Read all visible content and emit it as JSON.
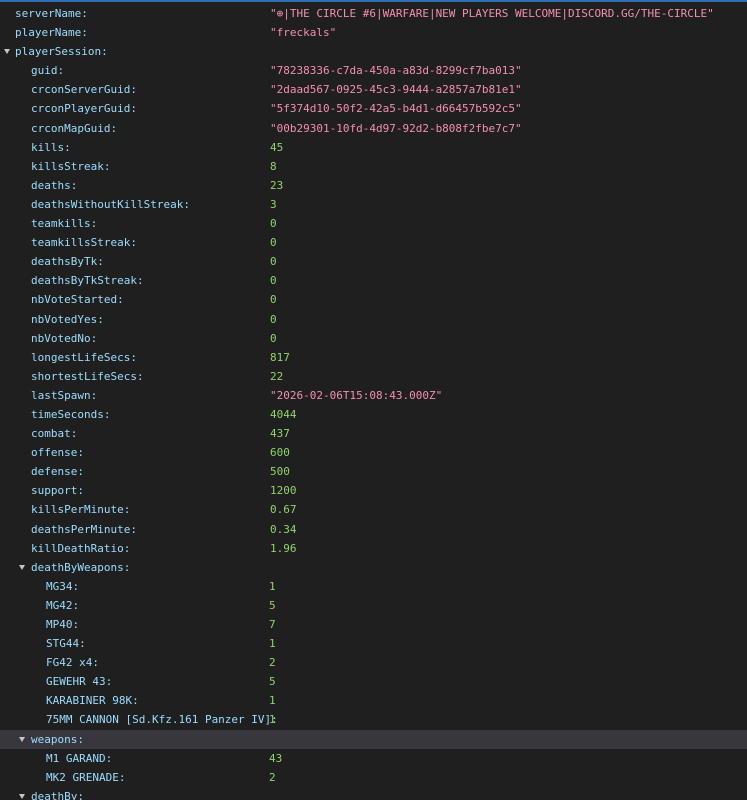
{
  "colors": {
    "background": "#1f1f1f",
    "key": "#9cdcfe",
    "string": "#f48fb1",
    "number": "#8fd46e",
    "selected_row": "#37373d",
    "accent": "#2f6fb8"
  },
  "rows": [
    {
      "depth": 0,
      "key": "serverName:",
      "value": "\"⊕|THE CIRCLE #6|WARFARE|NEW PLAYERS WELCOME|DISCORD.GG/THE-CIRCLE\"",
      "type": "str"
    },
    {
      "depth": 0,
      "key": "playerName:",
      "value": "\"freckals\"",
      "type": "str"
    },
    {
      "depth": 0,
      "key": "playerSession:",
      "expand": true
    },
    {
      "depth": 1,
      "key": "guid:",
      "value": "\"78238336-c7da-450a-a83d-8299cf7ba013\"",
      "type": "str"
    },
    {
      "depth": 1,
      "key": "crconServerGuid:",
      "value": "\"2daad567-0925-45c3-9444-a2857a7b81e1\"",
      "type": "str"
    },
    {
      "depth": 1,
      "key": "crconPlayerGuid:",
      "value": "\"5f374d10-50f2-42a5-b4d1-d66457b592c5\"",
      "type": "str"
    },
    {
      "depth": 1,
      "key": "crconMapGuid:",
      "value": "\"00b29301-10fd-4d97-92d2-b808f2fbe7c7\"",
      "type": "str"
    },
    {
      "depth": 1,
      "key": "kills:",
      "value": "45",
      "type": "num"
    },
    {
      "depth": 1,
      "key": "killsStreak:",
      "value": "8",
      "type": "num"
    },
    {
      "depth": 1,
      "key": "deaths:",
      "value": "23",
      "type": "num"
    },
    {
      "depth": 1,
      "key": "deathsWithoutKillStreak:",
      "value": "3",
      "type": "num"
    },
    {
      "depth": 1,
      "key": "teamkills:",
      "value": "0",
      "type": "num"
    },
    {
      "depth": 1,
      "key": "teamkillsStreak:",
      "value": "0",
      "type": "num"
    },
    {
      "depth": 1,
      "key": "deathsByTk:",
      "value": "0",
      "type": "num"
    },
    {
      "depth": 1,
      "key": "deathsByTkStreak:",
      "value": "0",
      "type": "num"
    },
    {
      "depth": 1,
      "key": "nbVoteStarted:",
      "value": "0",
      "type": "num"
    },
    {
      "depth": 1,
      "key": "nbVotedYes:",
      "value": "0",
      "type": "num"
    },
    {
      "depth": 1,
      "key": "nbVotedNo:",
      "value": "0",
      "type": "num"
    },
    {
      "depth": 1,
      "key": "longestLifeSecs:",
      "value": "817",
      "type": "num"
    },
    {
      "depth": 1,
      "key": "shortestLifeSecs:",
      "value": "22",
      "type": "num"
    },
    {
      "depth": 1,
      "key": "lastSpawn:",
      "value": "\"2026-02-06T15:08:43.000Z\"",
      "type": "str"
    },
    {
      "depth": 1,
      "key": "timeSeconds:",
      "value": "4044",
      "type": "num"
    },
    {
      "depth": 1,
      "key": "combat:",
      "value": "437",
      "type": "num"
    },
    {
      "depth": 1,
      "key": "offense:",
      "value": "600",
      "type": "num"
    },
    {
      "depth": 1,
      "key": "defense:",
      "value": "500",
      "type": "num"
    },
    {
      "depth": 1,
      "key": "support:",
      "value": "1200",
      "type": "num"
    },
    {
      "depth": 1,
      "key": "killsPerMinute:",
      "value": "0.67",
      "type": "num"
    },
    {
      "depth": 1,
      "key": "deathsPerMinute:",
      "value": "0.34",
      "type": "num"
    },
    {
      "depth": 1,
      "key": "killDeathRatio:",
      "value": "1.96",
      "type": "num"
    },
    {
      "depth": 1,
      "key": "deathByWeapons:",
      "expand": true
    },
    {
      "depth": 2,
      "key": "MG34:",
      "value": "1",
      "type": "num"
    },
    {
      "depth": 2,
      "key": "MG42:",
      "value": "5",
      "type": "num"
    },
    {
      "depth": 2,
      "key": "MP40:",
      "value": "7",
      "type": "num"
    },
    {
      "depth": 2,
      "key": "STG44:",
      "value": "1",
      "type": "num"
    },
    {
      "depth": 2,
      "key": "FG42 x4:",
      "value": "2",
      "type": "num"
    },
    {
      "depth": 2,
      "key": "GEWEHR 43:",
      "value": "5",
      "type": "num"
    },
    {
      "depth": 2,
      "key": "KARABINER 98K:",
      "value": "1",
      "type": "num"
    },
    {
      "depth": 2,
      "key": "75MM CANNON [Sd.Kfz.161 Panzer IV]:",
      "value": "1",
      "type": "num"
    },
    {
      "depth": 1,
      "key": "weapons:",
      "expand": true,
      "selected": true
    },
    {
      "depth": 2,
      "key": "M1 GARAND:",
      "value": "43",
      "type": "num"
    },
    {
      "depth": 2,
      "key": "MK2 GRENADE:",
      "value": "2",
      "type": "num"
    },
    {
      "depth": 1,
      "key": "deathBy:",
      "expand": true
    }
  ]
}
